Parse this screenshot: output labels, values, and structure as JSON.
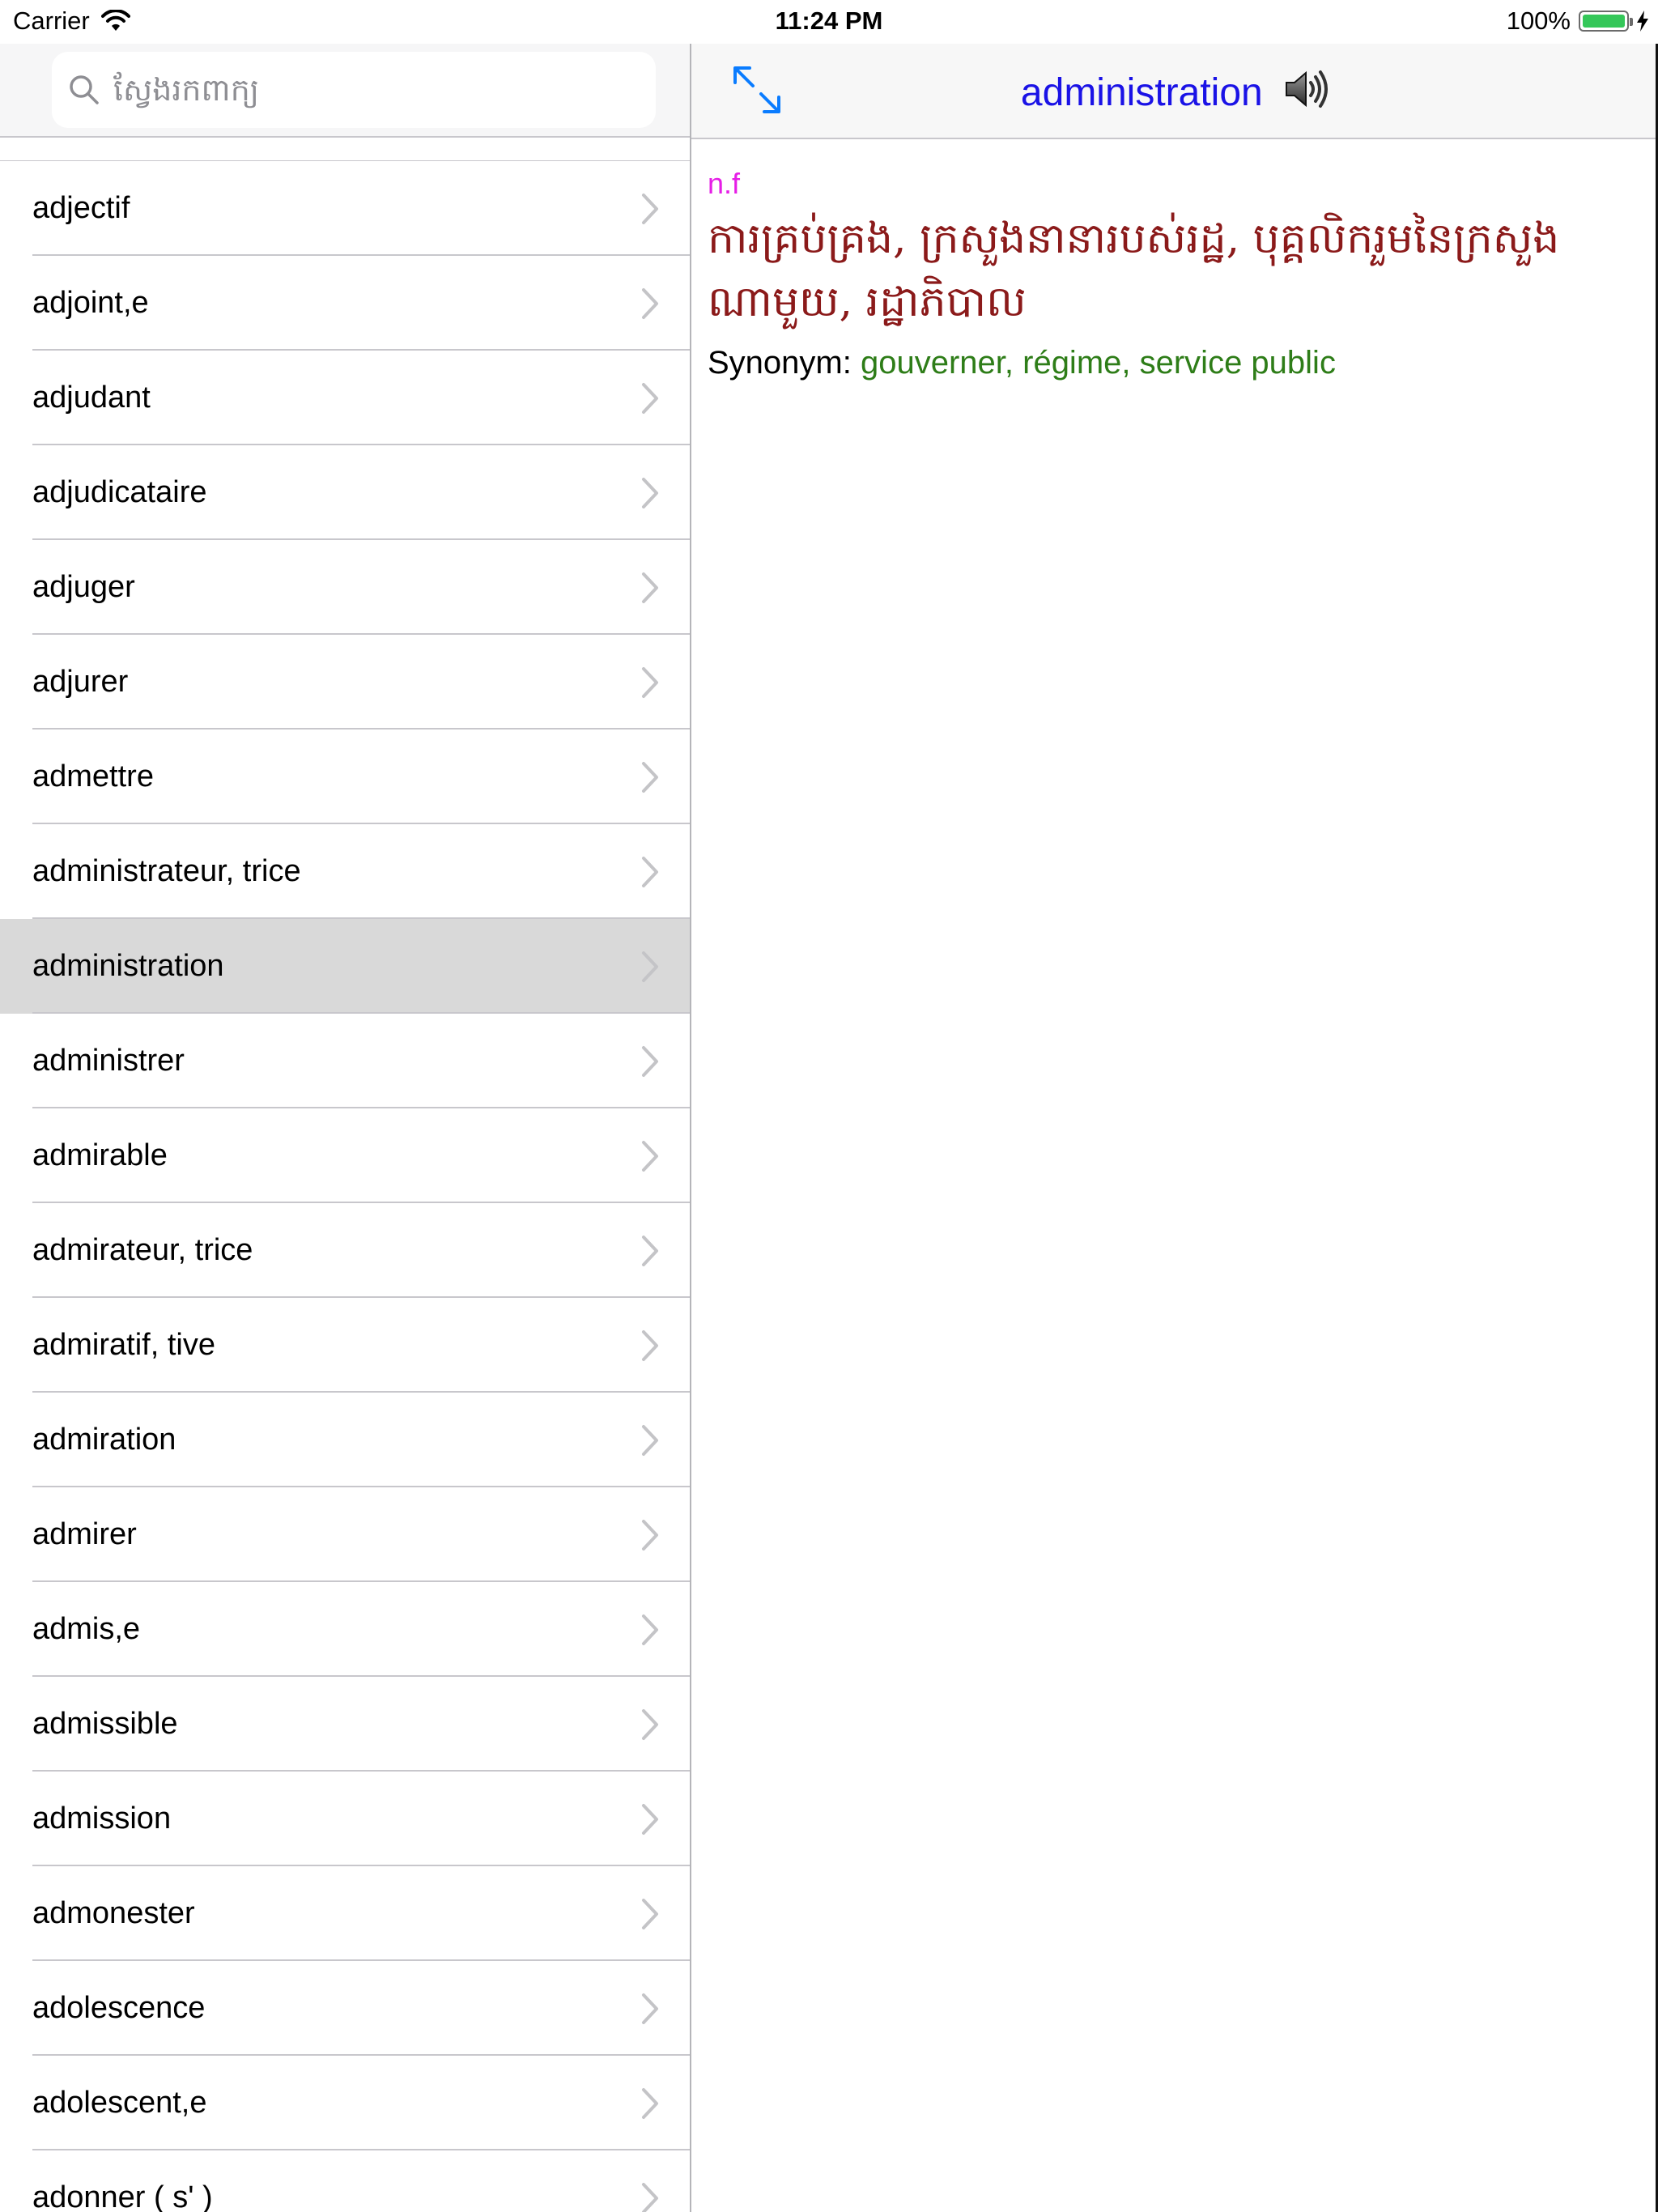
{
  "status_bar": {
    "carrier": "Carrier",
    "time": "11:24 PM",
    "battery": "100%"
  },
  "search": {
    "placeholder": "ស្វែងរកពាក្យ",
    "value": ""
  },
  "word_list": {
    "items": [
      "adjectif",
      "adjoint,e",
      "adjudant",
      "adjudicataire",
      "adjuger",
      "adjurer",
      "admettre",
      "administrateur, trice",
      "administration",
      "administrer",
      "admirable",
      "admirateur, trice",
      "admiratif, tive",
      "admiration",
      "admirer",
      "admis,e",
      "admissible",
      "admission",
      "admonester",
      "adolescence",
      "adolescent,e",
      "adonner ( s' )"
    ],
    "selected": "administration"
  },
  "detail": {
    "title": "administration",
    "part_of_speech": "n.f",
    "definition": "ការគ្រប់គ្រង, ក្រសួងនានារបស់រដ្ឋ, បុគ្គលិករួមនៃក្រសួងណាមួយ, រដ្ឋាភិបាល",
    "synonym_label": "Synonym:",
    "synonyms": "gouverner, régime, service public"
  },
  "colors": {
    "title": "#1a12e6",
    "part_of_speech": "#e61ee6",
    "definition": "#8b1a1a",
    "synonyms": "#2e7d18",
    "selected_row": "#d9d9d9",
    "accent": "#0a7cff"
  },
  "icons": {
    "search": "search-icon",
    "expand": "expand-arrows-icon",
    "speaker": "speaker-icon",
    "chevron": "chevron-right-icon",
    "wifi": "wifi-icon",
    "battery": "battery-icon",
    "charging": "charging-bolt-icon"
  }
}
